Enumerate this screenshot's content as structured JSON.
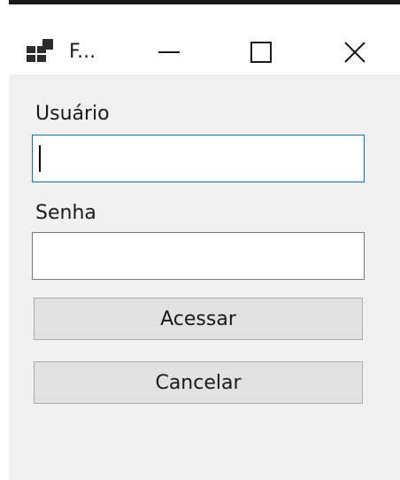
{
  "window": {
    "title": "F...",
    "icon": "winforms-app-icon",
    "controls": {
      "minimize_icon": "minimize-icon",
      "maximize_icon": "maximize-icon",
      "close_icon": "close-icon"
    }
  },
  "form": {
    "username_label": "Usuário",
    "username_value": "",
    "password_label": "Senha",
    "password_value": "",
    "submit_label": "Acessar",
    "cancel_label": "Cancelar"
  },
  "colors": {
    "focus_border": "#0078d7",
    "client_bg": "#f0f0f0",
    "button_bg": "#e1e1e1"
  }
}
